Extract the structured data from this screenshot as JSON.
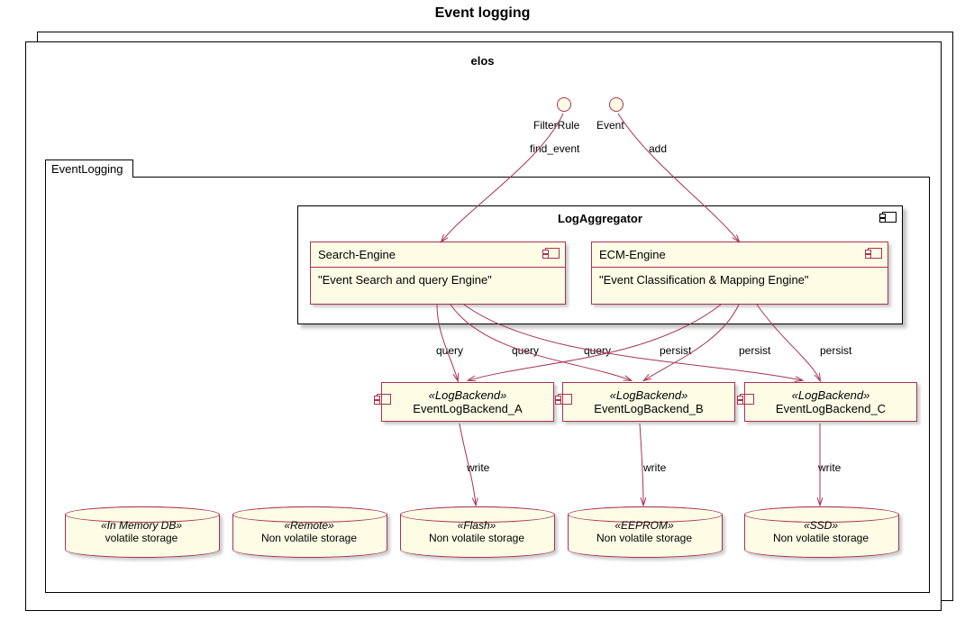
{
  "title": "Event logging",
  "container": "elos",
  "folder": "EventLogging",
  "aggregator": "LogAggregator",
  "search": {
    "name": "Search-Engine",
    "desc": "\"Event Search and query Engine\""
  },
  "ecm": {
    "name": "ECM-Engine",
    "desc": "\"Event Classification & Mapping Engine\""
  },
  "iface_filter": "FilterRule",
  "iface_event": "Event",
  "edge_find": "find_event",
  "edge_add": "add",
  "backend_stereo": "«LogBackend»",
  "backend_a": "EventLogBackend_A",
  "backend_b": "EventLogBackend_B",
  "backend_c": "EventLogBackend_C",
  "q": "query",
  "p": "persist",
  "w": "write",
  "db1": {
    "stereo": "«In Memory DB»",
    "label": "volatile storage"
  },
  "db2": {
    "stereo": "«Remote»",
    "label": "Non volatile storage"
  },
  "db3": {
    "stereo": "«Flash»",
    "label": "Non volatile storage"
  },
  "db4": {
    "stereo": "«EEPROM»",
    "label": "Non volatile storage"
  },
  "db5": {
    "stereo": "«SSD»",
    "label": "Non volatile storage"
  },
  "chart_data": {
    "type": "uml_component_diagram",
    "title": "Event logging",
    "nodes": [
      {
        "id": "elos",
        "kind": "node3d",
        "label": "elos"
      },
      {
        "id": "EventLogging",
        "kind": "package",
        "parent": "elos"
      },
      {
        "id": "LogAggregator",
        "kind": "component",
        "parent": "EventLogging"
      },
      {
        "id": "SearchEngine",
        "kind": "component",
        "parent": "LogAggregator",
        "label": "Search-Engine",
        "note": "Event Search and query Engine"
      },
      {
        "id": "ECMEngine",
        "kind": "component",
        "parent": "LogAggregator",
        "label": "ECM-Engine",
        "note": "Event Classification & Mapping Engine"
      },
      {
        "id": "FilterRule",
        "kind": "interface"
      },
      {
        "id": "Event",
        "kind": "interface"
      },
      {
        "id": "EventLogBackend_A",
        "kind": "component",
        "stereotype": "LogBackend",
        "parent": "EventLogging"
      },
      {
        "id": "EventLogBackend_B",
        "kind": "component",
        "stereotype": "LogBackend",
        "parent": "EventLogging"
      },
      {
        "id": "EventLogBackend_C",
        "kind": "component",
        "stereotype": "LogBackend",
        "parent": "EventLogging"
      },
      {
        "id": "InMemoryDB",
        "kind": "database",
        "stereotype": "In Memory DB",
        "label": "volatile storage",
        "parent": "EventLogging"
      },
      {
        "id": "Remote",
        "kind": "database",
        "stereotype": "Remote",
        "label": "Non volatile storage",
        "parent": "EventLogging"
      },
      {
        "id": "Flash",
        "kind": "database",
        "stereotype": "Flash",
        "label": "Non volatile storage",
        "parent": "EventLogging"
      },
      {
        "id": "EEPROM",
        "kind": "database",
        "stereotype": "EEPROM",
        "label": "Non volatile storage",
        "parent": "EventLogging"
      },
      {
        "id": "SSD",
        "kind": "database",
        "stereotype": "SSD",
        "label": "Non volatile storage",
        "parent": "EventLogging"
      }
    ],
    "edges": [
      {
        "from": "FilterRule",
        "to": "SearchEngine",
        "label": "find_event"
      },
      {
        "from": "Event",
        "to": "ECMEngine",
        "label": "add"
      },
      {
        "from": "SearchEngine",
        "to": "EventLogBackend_A",
        "label": "query"
      },
      {
        "from": "SearchEngine",
        "to": "EventLogBackend_B",
        "label": "query"
      },
      {
        "from": "SearchEngine",
        "to": "EventLogBackend_C",
        "label": "query"
      },
      {
        "from": "ECMEngine",
        "to": "EventLogBackend_A",
        "label": "persist"
      },
      {
        "from": "ECMEngine",
        "to": "EventLogBackend_B",
        "label": "persist"
      },
      {
        "from": "ECMEngine",
        "to": "EventLogBackend_C",
        "label": "persist"
      },
      {
        "from": "EventLogBackend_A",
        "to": "Flash",
        "label": "write"
      },
      {
        "from": "EventLogBackend_B",
        "to": "EEPROM",
        "label": "write"
      },
      {
        "from": "EventLogBackend_C",
        "to": "SSD",
        "label": "write"
      }
    ]
  }
}
